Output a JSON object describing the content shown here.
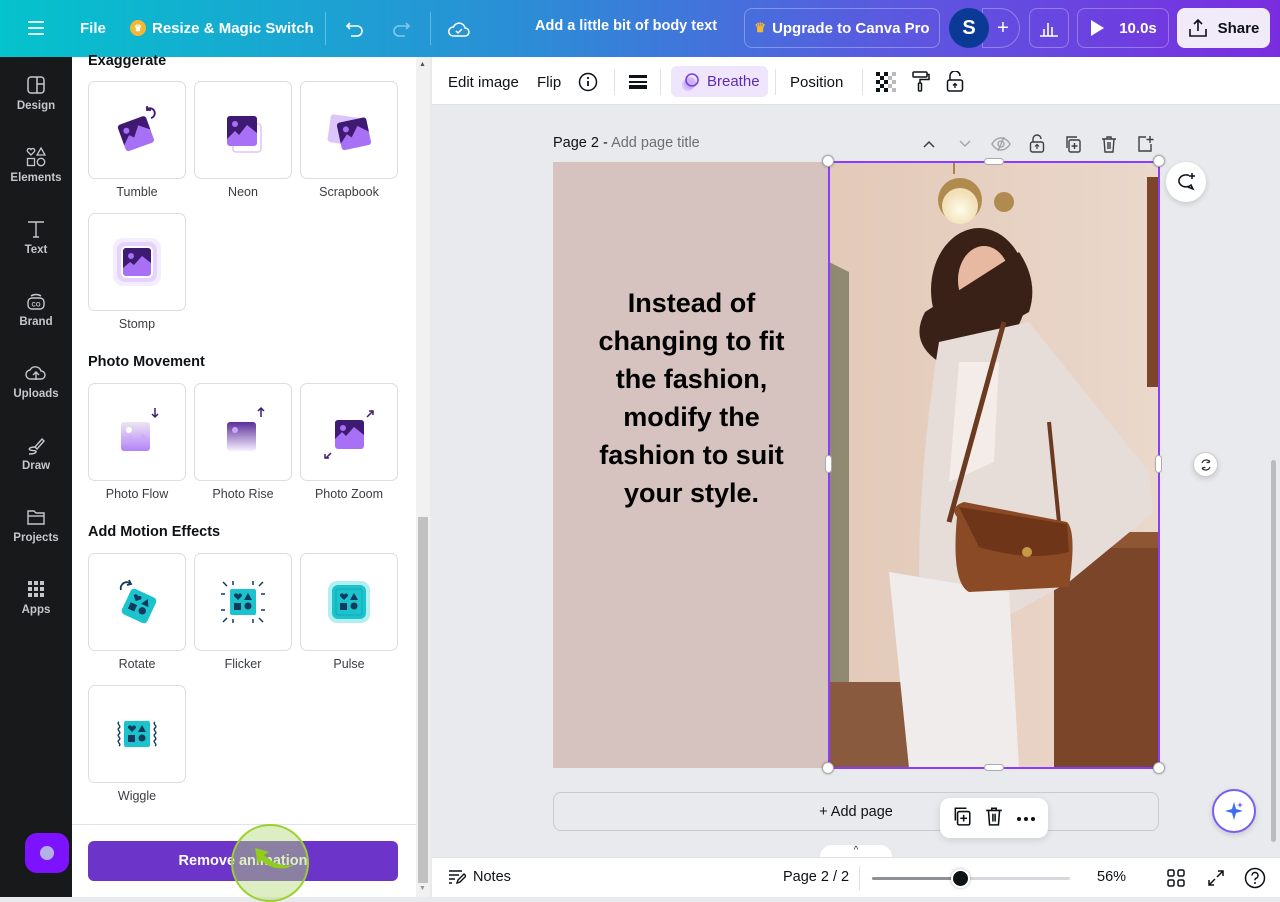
{
  "topbar": {
    "menu_icon": "hamburger-icon",
    "file_label": "File",
    "resize_label": "Resize & Magic Switch",
    "design_title": "Add a little bit of body text",
    "upgrade_label": "Upgrade to Canva Pro",
    "avatar_initial": "S",
    "add_collaborator": "+",
    "play_duration": "10.0s",
    "share_label": "Share"
  },
  "rail": {
    "items": [
      {
        "label": "Design",
        "icon": "design-icon"
      },
      {
        "label": "Elements",
        "icon": "elements-icon"
      },
      {
        "label": "Text",
        "icon": "text-icon"
      },
      {
        "label": "Brand",
        "icon": "brand-icon"
      },
      {
        "label": "Uploads",
        "icon": "uploads-icon"
      },
      {
        "label": "Draw",
        "icon": "draw-icon"
      },
      {
        "label": "Projects",
        "icon": "projects-icon"
      },
      {
        "label": "Apps",
        "icon": "apps-icon"
      }
    ]
  },
  "panel": {
    "sections": [
      {
        "title": "Exaggerate",
        "items": [
          "Tumble",
          "Neon",
          "Scrapbook",
          "Stomp"
        ]
      },
      {
        "title": "Photo Movement",
        "items": [
          "Photo Flow",
          "Photo Rise",
          "Photo Zoom"
        ]
      },
      {
        "title": "Add Motion Effects",
        "items": [
          "Rotate",
          "Flicker",
          "Pulse",
          "Wiggle"
        ]
      }
    ],
    "remove_label": "Remove animation"
  },
  "ctxbar": {
    "edit_image": "Edit image",
    "flip": "Flip",
    "animation": "Breathe",
    "position": "Position"
  },
  "canvas": {
    "page_label": "Page 2 -",
    "page_title_placeholder": "Add page title",
    "quote_lines": [
      "Instead of",
      "changing to fit",
      "the fashion,",
      "modify the",
      "fashion to suit",
      "your style."
    ],
    "add_page": "+ Add page"
  },
  "bottombar": {
    "notes": "Notes",
    "page_indicator": "Page 2 / 2",
    "zoom_percent": "56%",
    "zoom_fraction": 0.45
  },
  "colors": {
    "accent": "#8b3dff",
    "remove_button": "#6c34c9",
    "page_bg": "#d6c2be"
  }
}
